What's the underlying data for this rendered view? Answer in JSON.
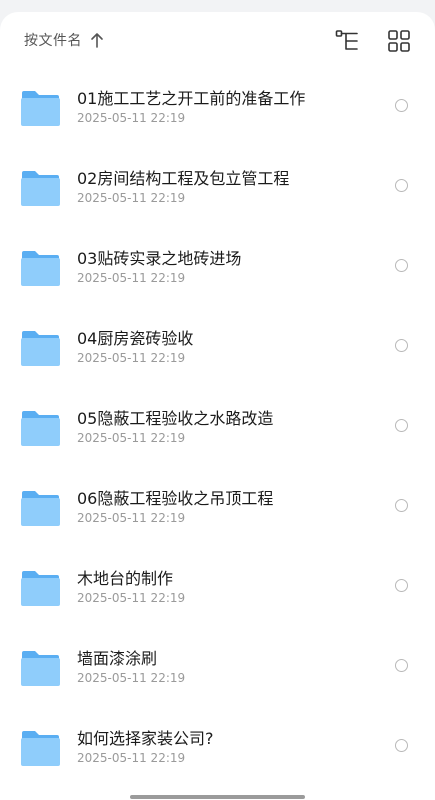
{
  "toolbar": {
    "sort_label": "按文件名",
    "sort_icon": "arrow-up-icon",
    "tree_icon": "tree-view-icon",
    "grid_icon": "grid-view-icon"
  },
  "colors": {
    "folder_back": "#5aaef2",
    "folder_front": "#8fcdfb",
    "accent": "#1b1b1b"
  },
  "items": [
    {
      "name": "01施工工艺之开工前的准备工作",
      "date": "2025-05-11 22:19"
    },
    {
      "name": "02房间结构工程及包立管工程",
      "date": "2025-05-11 22:19"
    },
    {
      "name": "03贴砖实录之地砖进场",
      "date": "2025-05-11 22:19"
    },
    {
      "name": "04厨房瓷砖验收",
      "date": "2025-05-11 22:19"
    },
    {
      "name": "05隐蔽工程验收之水路改造",
      "date": "2025-05-11 22:19"
    },
    {
      "name": "06隐蔽工程验收之吊顶工程",
      "date": "2025-05-11 22:19"
    },
    {
      "name": "木地台的制作",
      "date": "2025-05-11 22:19"
    },
    {
      "name": "墙面漆涂刷",
      "date": "2025-05-11 22:19"
    },
    {
      "name": "如何选择家装公司?",
      "date": "2025-05-11 22:19"
    }
  ]
}
